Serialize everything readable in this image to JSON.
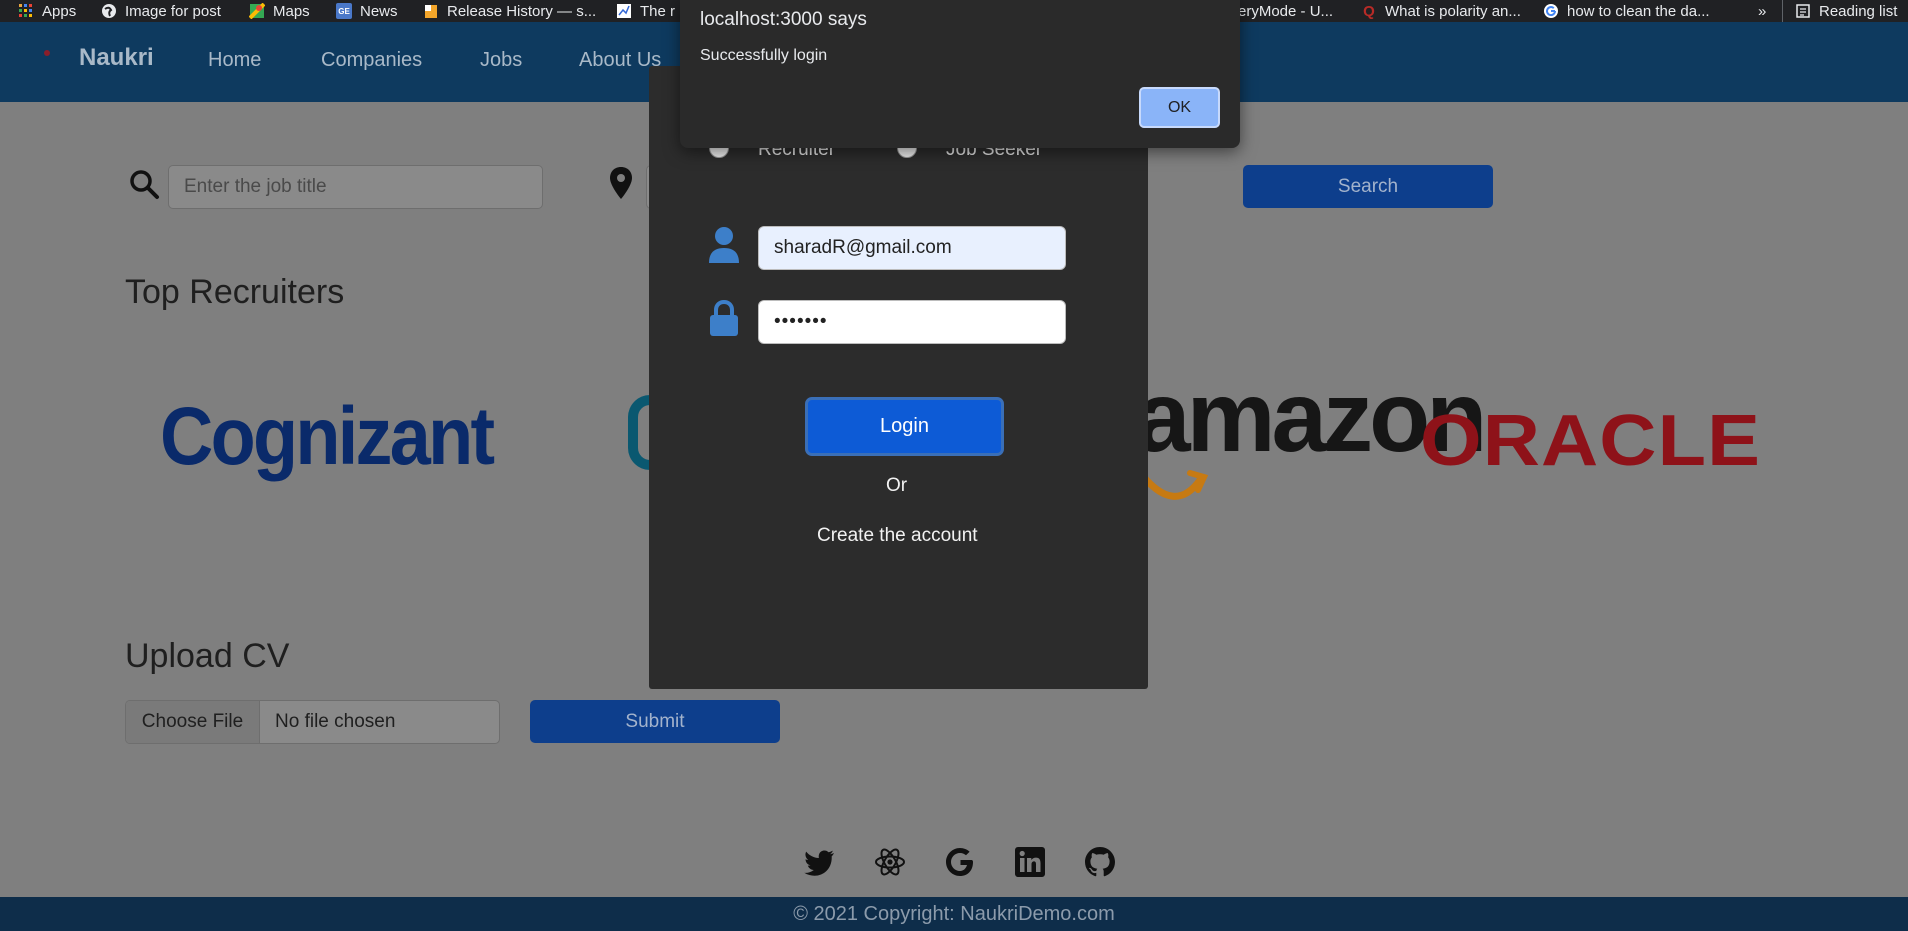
{
  "bookmarks": [
    {
      "label": "Apps",
      "icon": "apps-grid-icon"
    },
    {
      "label": "Image for post",
      "icon": "globe-icon"
    },
    {
      "label": "Maps",
      "icon": "maps-icon"
    },
    {
      "label": "News",
      "icon": "news-icon"
    },
    {
      "label": "Release History — s...",
      "icon": "bookmark-icon"
    },
    {
      "label": "The r",
      "icon": "chart-icon"
    },
    {
      "label": "eryMode - U...",
      "icon": "bookmark-icon"
    },
    {
      "label": "What is polarity an...",
      "icon": "quora-icon"
    },
    {
      "label": "how to clean the da...",
      "icon": "google-icon"
    },
    {
      "label": "»",
      "icon": ""
    },
    {
      "label": "Reading list",
      "icon": "reading-list-icon"
    }
  ],
  "navbar": {
    "brand": "Naukri",
    "links": [
      "Home",
      "Companies",
      "Jobs",
      "About Us"
    ]
  },
  "search": {
    "job_placeholder": "Enter the job title",
    "button": "Search"
  },
  "recruiters": {
    "title": "Top Recruiters",
    "logos": [
      "Cognizant",
      "amazon",
      "ORACLE"
    ]
  },
  "upload": {
    "title": "Upload CV",
    "choose_label": "Choose File",
    "no_file": "No file chosen",
    "submit": "Submit"
  },
  "footer": {
    "copyright": "© 2021 Copyright: NaukriDemo.com",
    "social_icons": [
      "twitter-icon",
      "react-icon",
      "google-icon",
      "linkedin-icon",
      "github-icon"
    ]
  },
  "login_modal": {
    "role_options": [
      "Recruiter",
      "Job Seeker"
    ],
    "email_value": "sharadR@gmail.com",
    "password_value": "•••••••",
    "login_button": "Login",
    "or_text": "Or",
    "create_account": "Create the account"
  },
  "alert": {
    "title": "localhost:3000 says",
    "message": "Successfully login",
    "ok_button": "OK"
  },
  "colors": {
    "navbar": "#0e3a5f",
    "primary_button": "#0d5bd6",
    "modal_bg": "#2c2c2c",
    "alert_ok": "#8ab4f8"
  }
}
